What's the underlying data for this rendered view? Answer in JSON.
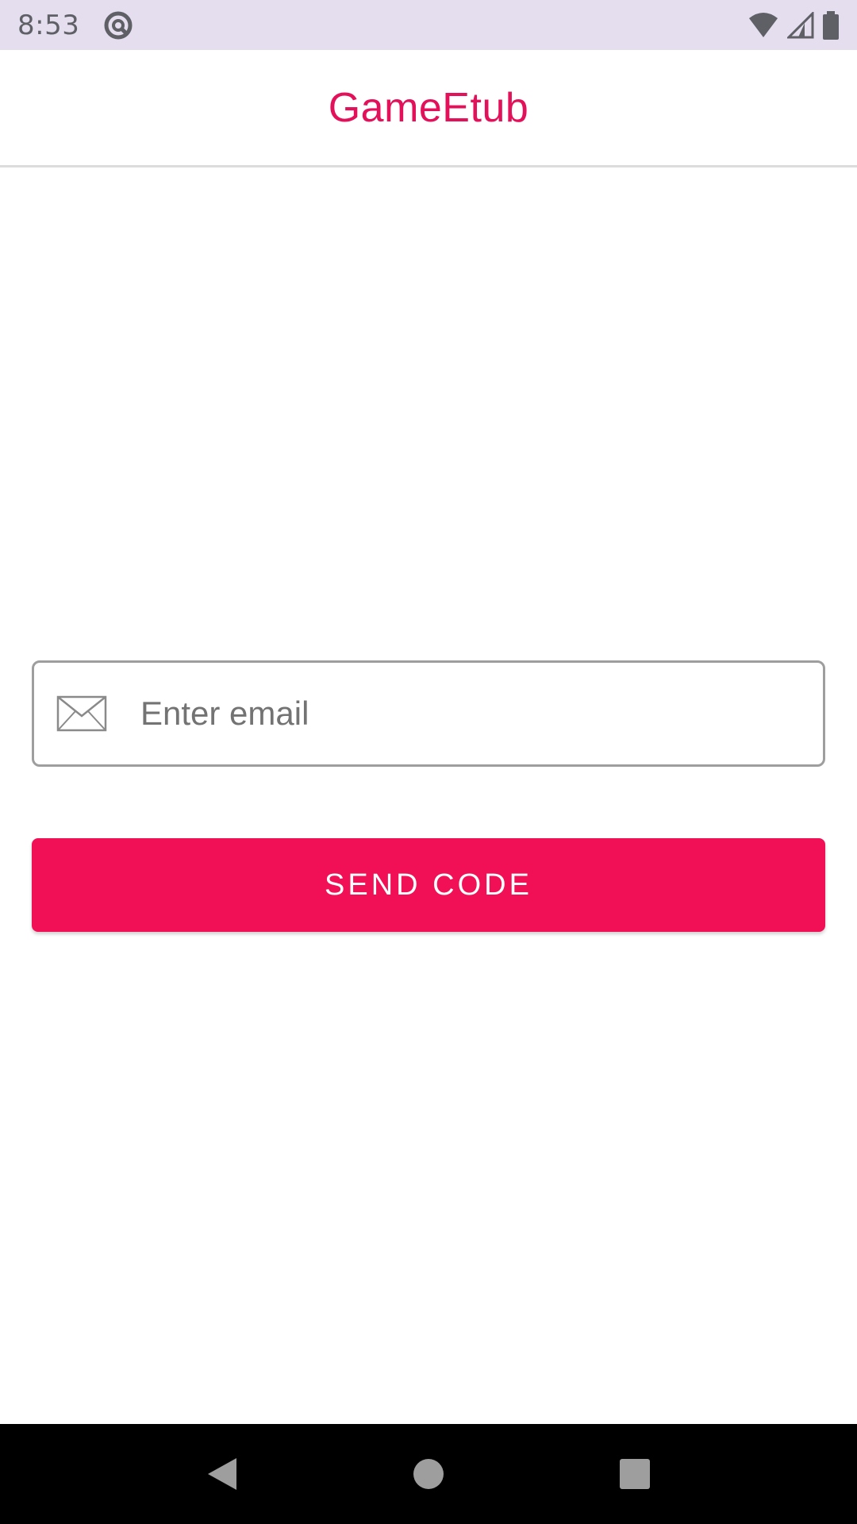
{
  "status_bar": {
    "time": "8:53",
    "icons": [
      "do-not-disturb-icon",
      "wifi-icon",
      "cell-signal-icon",
      "battery-icon"
    ]
  },
  "app_bar": {
    "title": "GameEtub"
  },
  "form": {
    "email_placeholder": "Enter email",
    "email_value": "",
    "email_icon": "mail-icon",
    "send_button_label": "SEND CODE"
  },
  "colors": {
    "accent": "#f10f55",
    "title": "#e3105a",
    "status_bar_bg": "#e4deee"
  },
  "nav_bar": {
    "buttons": [
      "back-icon",
      "home-icon",
      "recents-icon"
    ]
  }
}
